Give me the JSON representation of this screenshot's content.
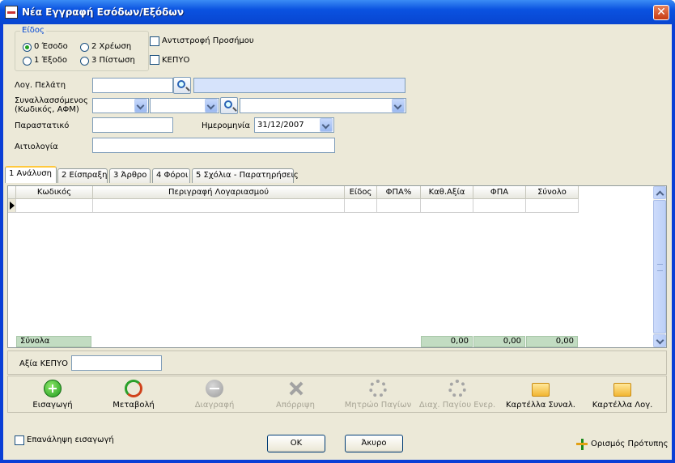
{
  "window": {
    "title": "Νέα Εγγραφή Εσόδων/Εξόδων",
    "close": "✕"
  },
  "type_group": {
    "legend": "Είδος",
    "options": [
      {
        "label": "0 Έσοδο",
        "selected": true
      },
      {
        "label": "2 Χρέωση",
        "selected": false
      },
      {
        "label": "1 Έξοδο",
        "selected": false
      },
      {
        "label": "3 Πίστωση",
        "selected": false
      }
    ]
  },
  "checks": {
    "reverse_sign": "Αντιστροφή Προσήμου",
    "kepyo": "ΚΕΠΥΟ"
  },
  "form": {
    "customer_account_label": "Λογ. Πελάτη",
    "counterparty_label_1": "Συναλλασσόμενος",
    "counterparty_label_2": "(Κωδικός, ΑΦΜ)",
    "document_label": "Παραστατικό",
    "date_label": "Ημερομηνία",
    "date_value": "31/12/2007",
    "reason_label": "Αιτιολογία"
  },
  "tabs": [
    "1 Ανάλυση",
    "2 Είσπραξη",
    "3 Άρθρο",
    "4 Φόροι",
    "5 Σχόλια - Παρατηρήσεις"
  ],
  "grid": {
    "columns": [
      "Κωδικός",
      "Περιγραφή Λογαριασμού",
      "Είδος",
      "ΦΠΑ%",
      "Καθ.Αξία",
      "ΦΠΑ",
      "Σύνολο"
    ],
    "totals_label": "Σύνολα",
    "totals": {
      "net": "0,00",
      "vat": "0,00",
      "total": "0,00"
    }
  },
  "kepyo_value_label": "Αξία ΚΕΠΥΟ",
  "toolbar": [
    {
      "label": "Εισαγωγή",
      "icon": "plus-icon",
      "enabled": true
    },
    {
      "label": "Μεταβολή",
      "icon": "change-icon",
      "enabled": true
    },
    {
      "label": "Διαγραφή",
      "icon": "minus-icon",
      "enabled": false
    },
    {
      "label": "Απόρριψη",
      "icon": "cross-icon",
      "enabled": false
    },
    {
      "label": "Μητρώο Παγίων",
      "icon": "gear-icon",
      "enabled": false
    },
    {
      "label": "Διαχ. Παγίου Ενερ.",
      "icon": "gear-icon",
      "enabled": false
    },
    {
      "label": "Καρτέλλα Συναλ.",
      "icon": "folder-icon",
      "enabled": true
    },
    {
      "label": "Καρτέλλα Λογ.",
      "icon": "folder-icon",
      "enabled": true
    }
  ],
  "footer": {
    "repeat_entry": "Επανάληψη εισαγωγή",
    "ok": "OK",
    "cancel": "Άκυρο",
    "template": "Ορισμός Πρότυπης"
  }
}
